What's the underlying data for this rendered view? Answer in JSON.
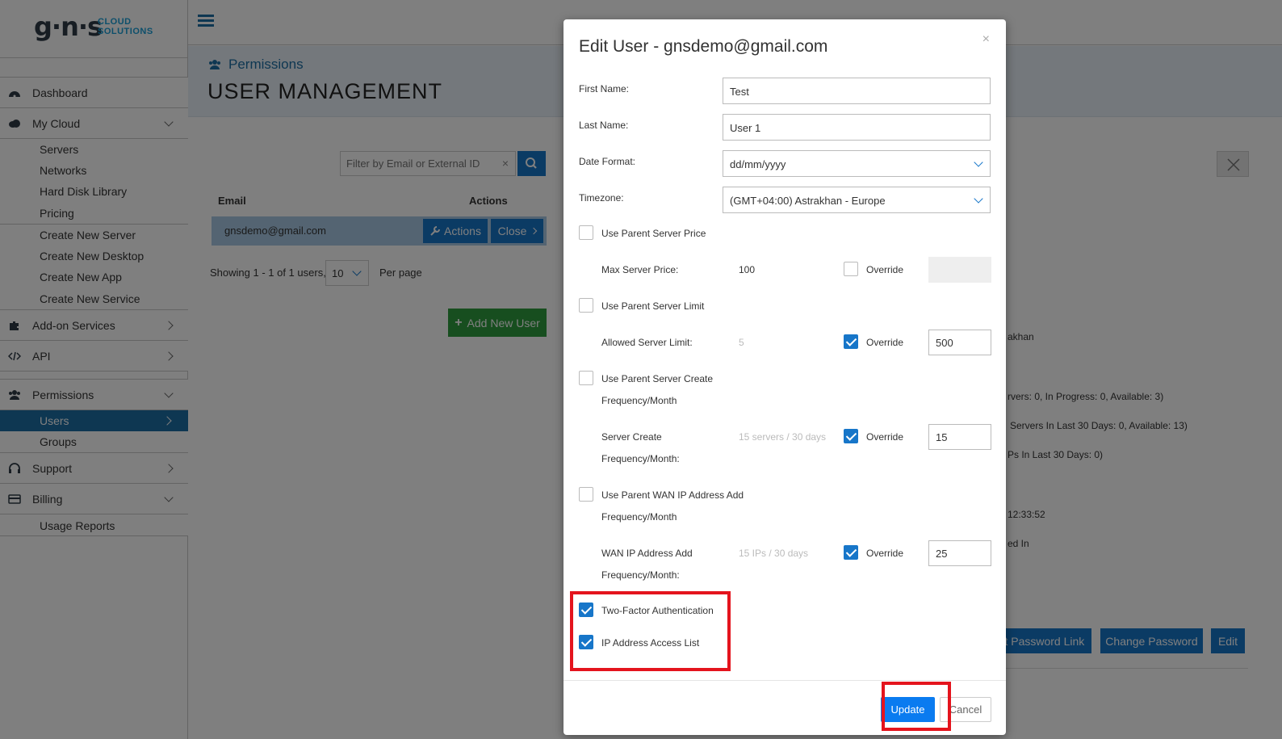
{
  "logo": {
    "mark": "g·n·s",
    "sub_line1": "CLOUD",
    "sub_line2": "SOLUTIONS"
  },
  "sidebar": {
    "dashboard": "Dashboard",
    "my_cloud": "My Cloud",
    "my_cloud_items": [
      "Servers",
      "Networks",
      "Hard Disk Library",
      "Pricing"
    ],
    "create_items": [
      "Create New Server",
      "Create New Desktop",
      "Create New App",
      "Create New Service"
    ],
    "addon": "Add-on Services",
    "api": "API",
    "permissions": "Permissions",
    "users": "Users",
    "groups": "Groups",
    "support": "Support",
    "billing": "Billing",
    "usage_reports": "Usage Reports"
  },
  "header": {
    "breadcrumb": "Permissions",
    "title": "USER MANAGEMENT"
  },
  "list": {
    "filter_placeholder": "Filter by Email or External ID",
    "col_email": "Email",
    "col_actions": "Actions",
    "row_email": "gnsdemo@gmail.com",
    "actions_label": "Actions",
    "close_label": "Close",
    "showing": "Showing 1 - 1 of 1 users,",
    "per_page_value": "10",
    "per_page_label": "Per page",
    "add_user": "Add New User"
  },
  "details": {
    "timezone_fragment": "akhan",
    "servers_fragment": "rvers: 0, In Progress: 0, Available: 3)",
    "servers_month_fragment": "Servers In Last 30 Days: 0, Available: 13)",
    "ips_fragment": "Ps In Last 30 Days: 0)",
    "time_fragment": "12:33:52",
    "logged_fragment": "ed In",
    "reset_link": "et Password Link",
    "change_password": "Change Password",
    "edit": "Edit"
  },
  "modal": {
    "title": "Edit User - gnsdemo@gmail.com",
    "first_name_label": "First Name:",
    "first_name": "Test",
    "last_name_label": "Last Name:",
    "last_name": "User 1",
    "date_format_label": "Date Format:",
    "date_format": "dd/mm/yyyy",
    "timezone_label": "Timezone:",
    "timezone": "(GMT+04:00) Astrakhan - Europe",
    "use_parent_price": "Use Parent Server Price",
    "max_price_label": "Max Server Price:",
    "max_price": "100",
    "override": "Override",
    "use_parent_limit": "Use Parent Server Limit",
    "allowed_limit_label": "Allowed Server Limit:",
    "allowed_limit_parent": "5",
    "allowed_limit": "500",
    "use_parent_create_1": "Use Parent Server Create",
    "use_parent_create_2": "Frequency/Month",
    "server_create_label_1": "Server Create",
    "server_create_label_2": "Frequency/Month:",
    "server_create_parent": "15 servers / 30 days",
    "server_create": "15",
    "use_parent_wan_1": "Use Parent WAN IP Address Add",
    "use_parent_wan_2": "Frequency/Month",
    "wan_label_1": "WAN IP Address Add",
    "wan_label_2": "Frequency/Month:",
    "wan_parent": "15 IPs / 30 days",
    "wan": "25",
    "two_factor": "Two-Factor Authentication",
    "ip_access": "IP Address Access List",
    "update": "Update",
    "cancel": "Cancel"
  },
  "colors": {
    "primary": "#1776c9",
    "success": "#2e9c3e",
    "highlight": "#e4141d",
    "active_nav": "#1c6ea4"
  }
}
